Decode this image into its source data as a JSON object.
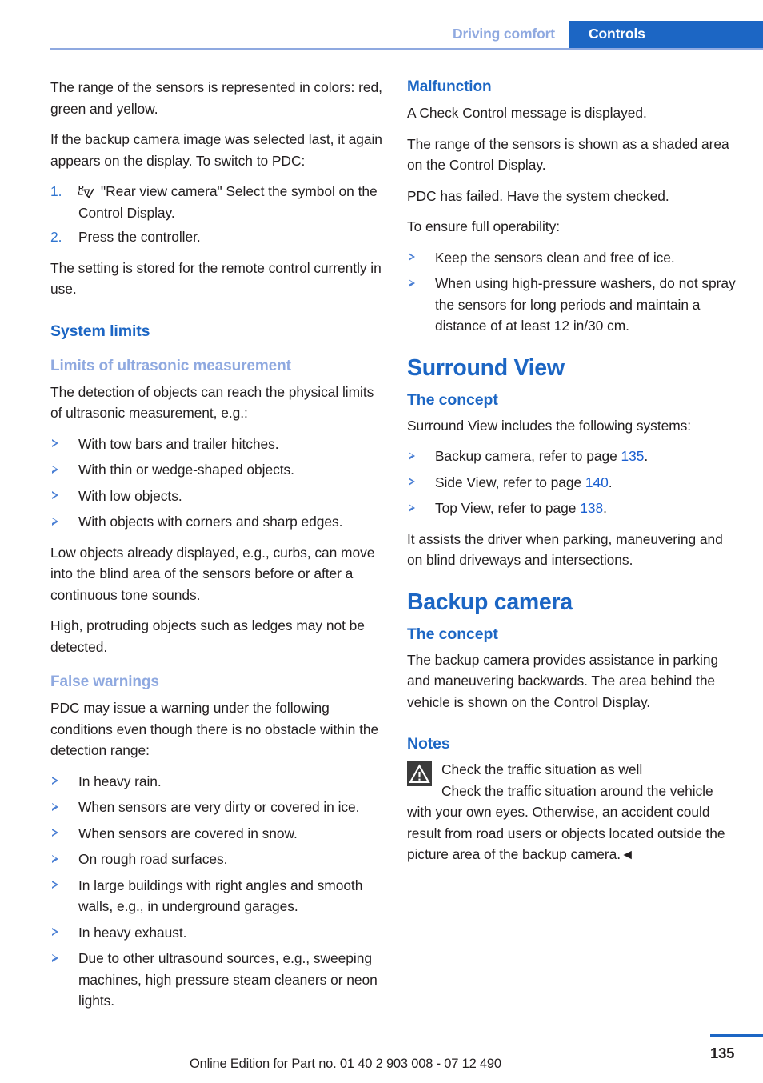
{
  "header": {
    "chapter": "Driving comfort",
    "section": "Controls"
  },
  "left_column": {
    "p1": "The range of the sensors is represented in colors: red, green and yellow.",
    "p2": "If the backup camera image was selected last, it again appears on the display. To switch to PDC:",
    "steps": [
      {
        "num": "1.",
        "icon": "rear-view-camera-icon",
        "text": "\"Rear view camera\" Select the symbol on the Control Display."
      },
      {
        "num": "2.",
        "text": "Press the controller."
      }
    ],
    "p3": "The setting is stored for the remote control currently in use.",
    "h2_system_limits": "System limits",
    "h3_limits_ultrasonic": "Limits of ultrasonic measurement",
    "p4": "The detection of objects can reach the physical limits of ultrasonic measurement, e.g.:",
    "bullets_limits": [
      "With tow bars and trailer hitches.",
      "With thin or wedge-shaped objects.",
      "With low objects.",
      "With objects with corners and sharp edges."
    ],
    "p5": "Low objects already displayed, e.g., curbs, can move into the blind area of the sensors before or after a continuous tone sounds.",
    "p6": "High, protruding objects such as ledges may not be detected.",
    "h3_false_warnings": "False warnings",
    "p7": "PDC may issue a warning under the following conditions even though there is no obstacle within the detection range:",
    "bullets_false": [
      "In heavy rain.",
      "When sensors are very dirty or covered in ice.",
      "When sensors are covered in snow.",
      "On rough road surfaces.",
      "In large buildings with right angles and smooth walls, e.g., in underground garages.",
      "In heavy exhaust.",
      "Due to other ultrasound sources, e.g., sweeping machines, high pressure steam cleaners or neon lights."
    ]
  },
  "right_column": {
    "h3_malfunction": "Malfunction",
    "p1": "A Check Control message is displayed.",
    "p2": "The range of the sensors is shown as a shaded area on the Control Display.",
    "p3": "PDC has failed. Have the system checked.",
    "p4": "To ensure full operability:",
    "bullets_operability": [
      "Keep the sensors clean and free of ice.",
      "When using high-pressure washers, do not spray the sensors for long periods and maintain a distance of at least 12 in/30 cm."
    ],
    "h1_surround_view": "Surround View",
    "h2_concept_sv": "The concept",
    "p5": "Surround View includes the following systems:",
    "bullets_systems": [
      {
        "text_before": "Backup camera, refer to page ",
        "page": "135",
        "text_after": "."
      },
      {
        "text_before": "Side View, refer to page ",
        "page": "140",
        "text_after": "."
      },
      {
        "text_before": "Top View, refer to page ",
        "page": "138",
        "text_after": "."
      }
    ],
    "p6": "It assists the driver when parking, maneuvering and on blind driveways and intersections.",
    "h1_backup_camera": "Backup camera",
    "h2_concept_bc": "The concept",
    "p7": "The backup camera provides assistance in parking and maneuvering backwards. The area behind the vehicle is shown on the Control Display.",
    "h2_notes": "Notes",
    "note": {
      "icon": "warning-triangle-icon",
      "title": "Check the traffic situation as well",
      "body": "Check the traffic situation around the vehicle with your own eyes. Otherwise, an accident could result from road users or objects located outside the picture area of the backup camera.",
      "end_mark": "◄"
    }
  },
  "footer": {
    "edition_text": "Online Edition for Part no. 01 40 2 903 008 - 07 12 490",
    "page_number": "135"
  },
  "colors": {
    "accent_blue": "#1c66c4",
    "light_blue": "#8fa9e0",
    "link_blue": "#1a5fd0",
    "bullet_blue": "#4a7fd4",
    "text": "#231f20",
    "warn_icon_bg": "#3b3b3b"
  }
}
